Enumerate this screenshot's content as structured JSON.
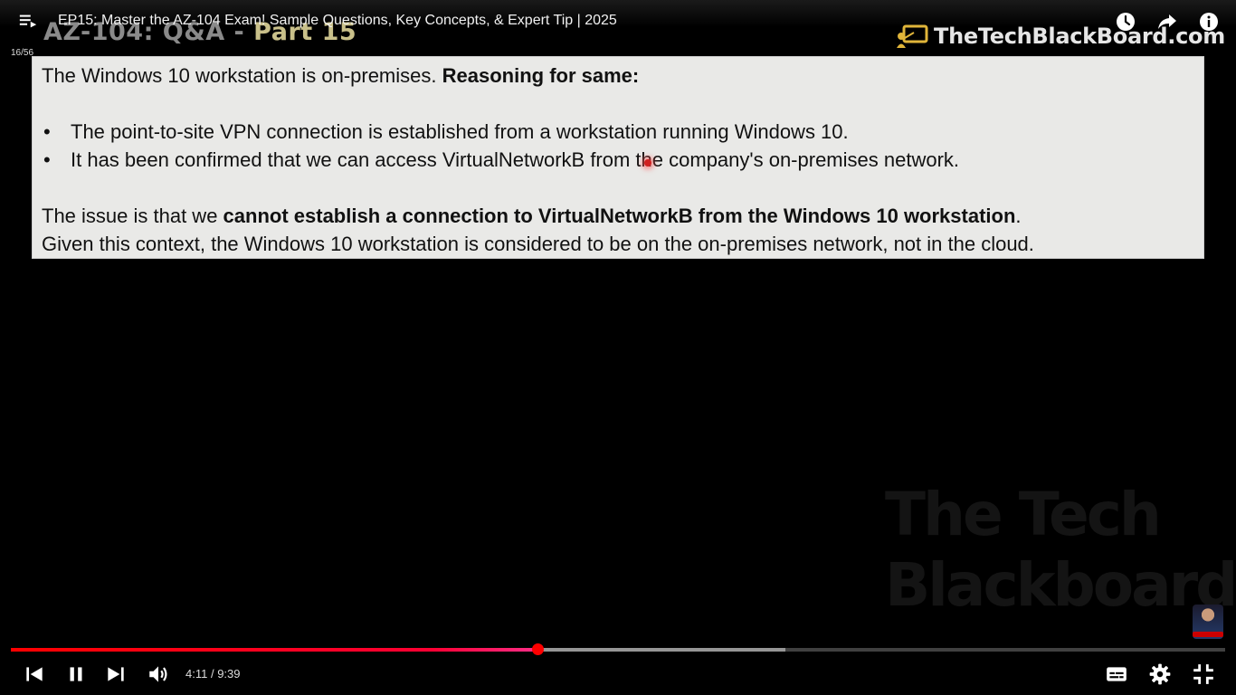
{
  "player": {
    "title": "EP15: Master the AZ-104 Exam! Sample Questions, Key Concepts, & Expert Tip | 2025",
    "playlist_position": "16/56",
    "time_current": "4:11",
    "time_separator": " / ",
    "time_total": "9:39",
    "progress": {
      "played_fraction": 0.434,
      "buffered_fraction": 0.638
    },
    "colors": {
      "progress": "#ff0000",
      "background": "#000000"
    },
    "icons": {
      "top_left": "playlist-icon",
      "top_right": [
        "watch-later-icon",
        "share-icon",
        "info-icon"
      ],
      "bottom_left": [
        "previous-icon",
        "pause-icon",
        "next-icon",
        "volume-icon"
      ],
      "bottom_right": [
        "subtitles-icon",
        "settings-icon",
        "exit-fullscreen-icon"
      ]
    }
  },
  "slide": {
    "heading_main": "AZ-104: Q&A - ",
    "heading_part": "Part 15",
    "brand": "TheTechBlackBoard.com",
    "intro_plain": "The Windows 10 workstation is on-premises. ",
    "intro_bold": "Reasoning for same:",
    "bullets": [
      "The point-to-site VPN connection is established from a workstation running Windows 10.",
      "It has been confirmed that we can access VirtualNetworkB from the company's on-premises network."
    ],
    "issue_plain": "The issue is that we ",
    "issue_bold": "cannot establish a connection to VirtualNetworkB from the Windows 10 workstation",
    "issue_end": ".",
    "conclusion": "Given this context, the Windows 10 workstation is considered to be on the on-premises network, not in the cloud.",
    "watermark_line1": "The Tech",
    "watermark_line2": "Blackboard"
  }
}
